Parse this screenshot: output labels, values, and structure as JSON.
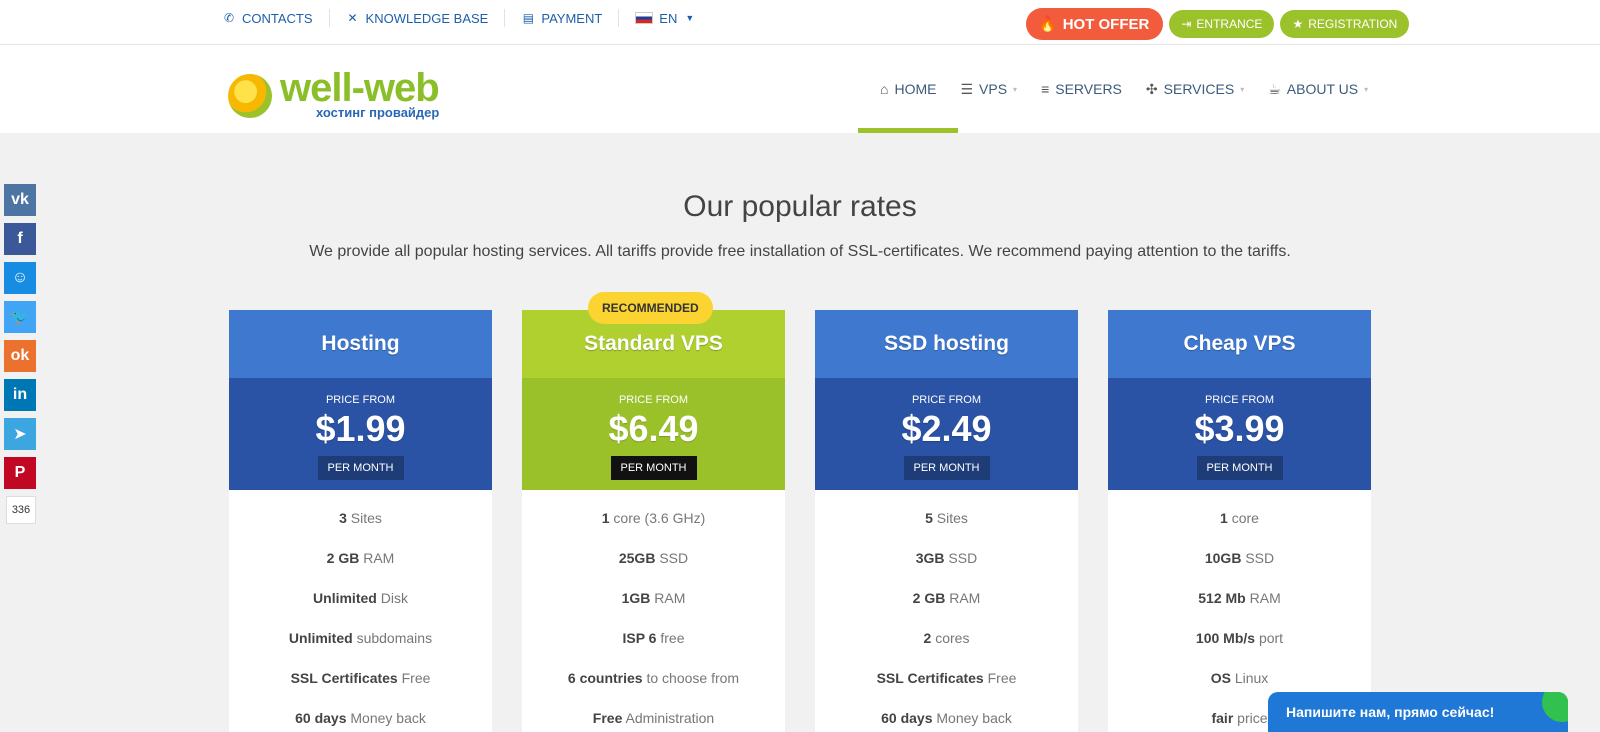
{
  "topbar": {
    "links": [
      {
        "label": "CONTACTS",
        "icon": "phone-icon"
      },
      {
        "label": "KNOWLEDGE BASE",
        "icon": "tools-icon"
      },
      {
        "label": "PAYMENT",
        "icon": "document-icon"
      },
      {
        "label": "EN",
        "icon": "flag-icon"
      }
    ],
    "hot_offer": "HOT OFFER",
    "entrance": "ENTRANCE",
    "registration": "REGISTRATION"
  },
  "logo": {
    "name": "well-web",
    "tagline": "хостинг провайдер"
  },
  "nav": [
    {
      "label": "HOME",
      "icon": "home-icon",
      "active": true
    },
    {
      "label": "VPS",
      "icon": "list-icon",
      "dropdown": true
    },
    {
      "label": "SERVERS",
      "icon": "menu-icon"
    },
    {
      "label": "SERVICES",
      "icon": "puzzle-icon",
      "dropdown": true
    },
    {
      "label": "ABOUT US",
      "icon": "cup-icon",
      "dropdown": true
    }
  ],
  "social": {
    "items": [
      {
        "name": "vk",
        "label": "vk",
        "color": "#4c75a3"
      },
      {
        "name": "facebook",
        "label": "f",
        "color": "#3b5998"
      },
      {
        "name": "moimir",
        "label": "☺",
        "color": "#168de2"
      },
      {
        "name": "twitter",
        "label": "🐦",
        "color": "#42a4f5"
      },
      {
        "name": "odnoklassniki",
        "label": "ok",
        "color": "#eb722e"
      },
      {
        "name": "linkedin",
        "label": "in",
        "color": "#0077b5"
      },
      {
        "name": "telegram",
        "label": "➤",
        "color": "#3ca6e0"
      },
      {
        "name": "pinterest",
        "label": "P",
        "color": "#c20724"
      }
    ],
    "count": "336"
  },
  "main": {
    "title": "Our popular rates",
    "subtitle": "We provide all popular hosting services. All tariffs provide free installation of SSL-certificates. We recommend paying attention to the tariffs."
  },
  "plans": [
    {
      "name": "Hosting",
      "price_from": "PRICE FROM",
      "price": "$1.99",
      "per": "PER MONTH",
      "head_color": "#3f78cf",
      "price_color": "#2a52a5",
      "features": [
        [
          "3",
          " Sites"
        ],
        [
          "2 GB",
          " RAM"
        ],
        [
          "Unlimited",
          " Disk"
        ],
        [
          "Unlimited",
          " subdomains"
        ],
        [
          "SSL Certificates",
          " Free"
        ],
        [
          "60 days",
          " Money back"
        ]
      ]
    },
    {
      "name": "Standard VPS",
      "price_from": "PRICE FROM",
      "price": "$6.49",
      "per": "PER MONTH",
      "head_color": "#b0d030",
      "price_color": "#9bc12a",
      "badge": "RECOMMENDED",
      "features": [
        [
          "1",
          " core (3.6 GHz)"
        ],
        [
          "25GB",
          " SSD"
        ],
        [
          "1GB",
          " RAM"
        ],
        [
          "ISP 6",
          " free"
        ],
        [
          "6 countries",
          " to choose from"
        ],
        [
          "Free",
          " Administration"
        ]
      ]
    },
    {
      "name": "SSD hosting",
      "price_from": "PRICE FROM",
      "price": "$2.49",
      "per": "PER MONTH",
      "head_color": "#3f78cf",
      "price_color": "#2a52a5",
      "features": [
        [
          "5",
          " Sites"
        ],
        [
          "3GB",
          " SSD"
        ],
        [
          "2 GB",
          " RAM"
        ],
        [
          "2",
          " cores"
        ],
        [
          "SSL Certificates",
          " Free"
        ],
        [
          "60 days",
          " Money back"
        ]
      ]
    },
    {
      "name": "Cheap VPS",
      "price_from": "PRICE FROM",
      "price": "$3.99",
      "per": "PER MONTH",
      "head_color": "#3f78cf",
      "price_color": "#2a52a5",
      "features": [
        [
          "1",
          " core"
        ],
        [
          "10GB",
          " SSD"
        ],
        [
          "512 Mb",
          " RAM"
        ],
        [
          "100 Mb/s",
          " port"
        ],
        [
          "OS",
          " Linux"
        ],
        [
          "fair",
          " price"
        ]
      ]
    }
  ],
  "chat": {
    "label": "Напишите нам, прямо сейчас!"
  }
}
